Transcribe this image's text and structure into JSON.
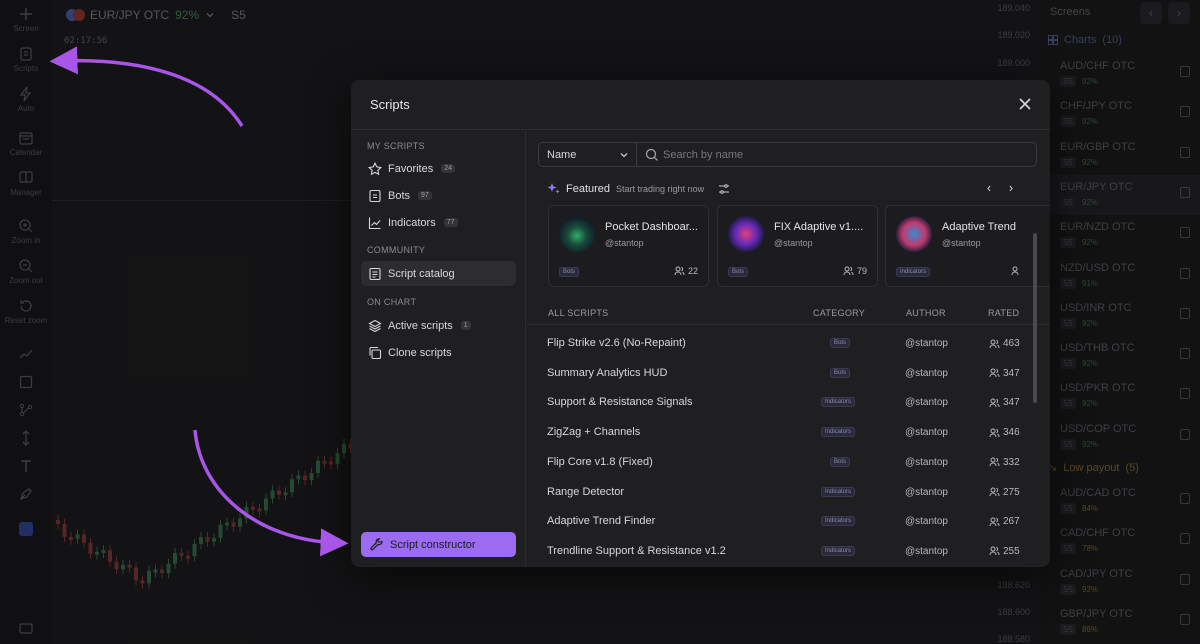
{
  "toolbar": {
    "items": [
      {
        "label": "Screen",
        "icon": "plus-icon"
      },
      {
        "label": "Scripts",
        "icon": "scripts-icon"
      },
      {
        "label": "Auto",
        "icon": "lightning-icon"
      },
      {
        "label": "Calendar",
        "icon": "calendar-icon"
      },
      {
        "label": "Manager",
        "icon": "manager-icon"
      },
      {
        "label": "Zoom in",
        "icon": "zoom-in-icon"
      },
      {
        "label": "Zoom out",
        "icon": "zoom-out-icon"
      },
      {
        "label": "Reset zoom",
        "icon": "reset-zoom-icon"
      }
    ],
    "swatch_color": "#2a3a7a"
  },
  "chart": {
    "pair": "EUR/JPY OTC",
    "payout": "92%",
    "timeframe": "S5",
    "timer": "02:17:56",
    "prices": [
      "189.040",
      "189.020",
      "189.000",
      "188.620",
      "188.600",
      "188.580"
    ]
  },
  "right_sidebar": {
    "title": "Screens",
    "charts_group": "Charts",
    "charts_count": "(10)",
    "low_group": "Low payout",
    "low_count": "(5)",
    "pairs": [
      {
        "name": "AUD/CHF OTC",
        "tf": "S5",
        "pct": "92%"
      },
      {
        "name": "CHF/JPY OTC",
        "tf": "S5",
        "pct": "92%"
      },
      {
        "name": "EUR/GBP OTC",
        "tf": "S5",
        "pct": "92%"
      },
      {
        "name": "EUR/JPY OTC",
        "tf": "S5",
        "pct": "92%"
      },
      {
        "name": "EUR/NZD OTC",
        "tf": "S5",
        "pct": "92%"
      },
      {
        "name": "NZD/USD OTC",
        "tf": "S5",
        "pct": "91%"
      },
      {
        "name": "USD/INR OTC",
        "tf": "S5",
        "pct": "92%"
      },
      {
        "name": "USD/THB OTC",
        "tf": "S5",
        "pct": "92%"
      },
      {
        "name": "USD/PKR OTC",
        "tf": "S5",
        "pct": "92%"
      },
      {
        "name": "USD/COP OTC",
        "tf": "S5",
        "pct": "92%"
      }
    ],
    "low_pairs": [
      {
        "name": "AUD/CAD OTC",
        "tf": "S5",
        "pct": "84%"
      },
      {
        "name": "CAD/CHF OTC",
        "tf": "S5",
        "pct": "78%"
      },
      {
        "name": "CAD/JPY OTC",
        "tf": "S5",
        "pct": "92%"
      },
      {
        "name": "GBP/JPY OTC",
        "tf": "S5",
        "pct": "86%"
      }
    ]
  },
  "modal": {
    "title": "Scripts",
    "sections": {
      "my_scripts": "MY SCRIPTS",
      "community": "COMMUNITY",
      "on_chart": "ON CHART"
    },
    "nav": {
      "favorites": {
        "label": "Favorites",
        "count": "24"
      },
      "bots": {
        "label": "Bots",
        "count": "97"
      },
      "indicators": {
        "label": "Indicators",
        "count": "77"
      },
      "catalog": {
        "label": "Script catalog"
      },
      "active": {
        "label": "Active scripts",
        "count": "1"
      },
      "clone": {
        "label": "Clone scripts"
      }
    },
    "constructor_label": "Script constructor",
    "sort": {
      "value": "Name"
    },
    "search": {
      "placeholder": "Search by name"
    },
    "featured": {
      "title": "Featured",
      "subtitle": "Start trading right now"
    },
    "cards": [
      {
        "title": "Pocket Dashboar...",
        "author": "@stantop",
        "badge": "Bots",
        "users": "22"
      },
      {
        "title": "FIX Adaptive v1....",
        "author": "@stantop",
        "badge": "Bots",
        "users": "79"
      },
      {
        "title": "Adaptive Trend",
        "author": "@stantop",
        "badge": "Indicators",
        "users": ""
      }
    ],
    "table": {
      "headers": {
        "name": "ALL SCRIPTS",
        "category": "CATEGORY",
        "author": "AUTHOR",
        "rated": "RATED"
      },
      "rows": [
        {
          "name": "Flip Strike v2.6 (No-Repaint)",
          "category": "Bots",
          "author": "@stantop",
          "rated": "463"
        },
        {
          "name": "Summary Analytics HUD",
          "category": "Bots",
          "author": "@stantop",
          "rated": "347"
        },
        {
          "name": "Support & Resistance Signals",
          "category": "Indicators",
          "author": "@stantop",
          "rated": "347"
        },
        {
          "name": "ZigZag + Channels",
          "category": "Indicators",
          "author": "@stantop",
          "rated": "346"
        },
        {
          "name": "Flip Core v1.8 (Fixed)",
          "category": "Bots",
          "author": "@stantop",
          "rated": "332"
        },
        {
          "name": "Range Detector",
          "category": "Indicators",
          "author": "@stantop",
          "rated": "275"
        },
        {
          "name": "Adaptive Trend Finder",
          "category": "Indicators",
          "author": "@stantop",
          "rated": "267"
        },
        {
          "name": "Trendline Support & Resistance v1.2",
          "category": "Indicators",
          "author": "@stantop",
          "rated": "255"
        }
      ]
    }
  },
  "colors": {
    "accent": "#9b6cf0",
    "arrow": "#a855e8",
    "modal_bg": "#1f1f22"
  }
}
